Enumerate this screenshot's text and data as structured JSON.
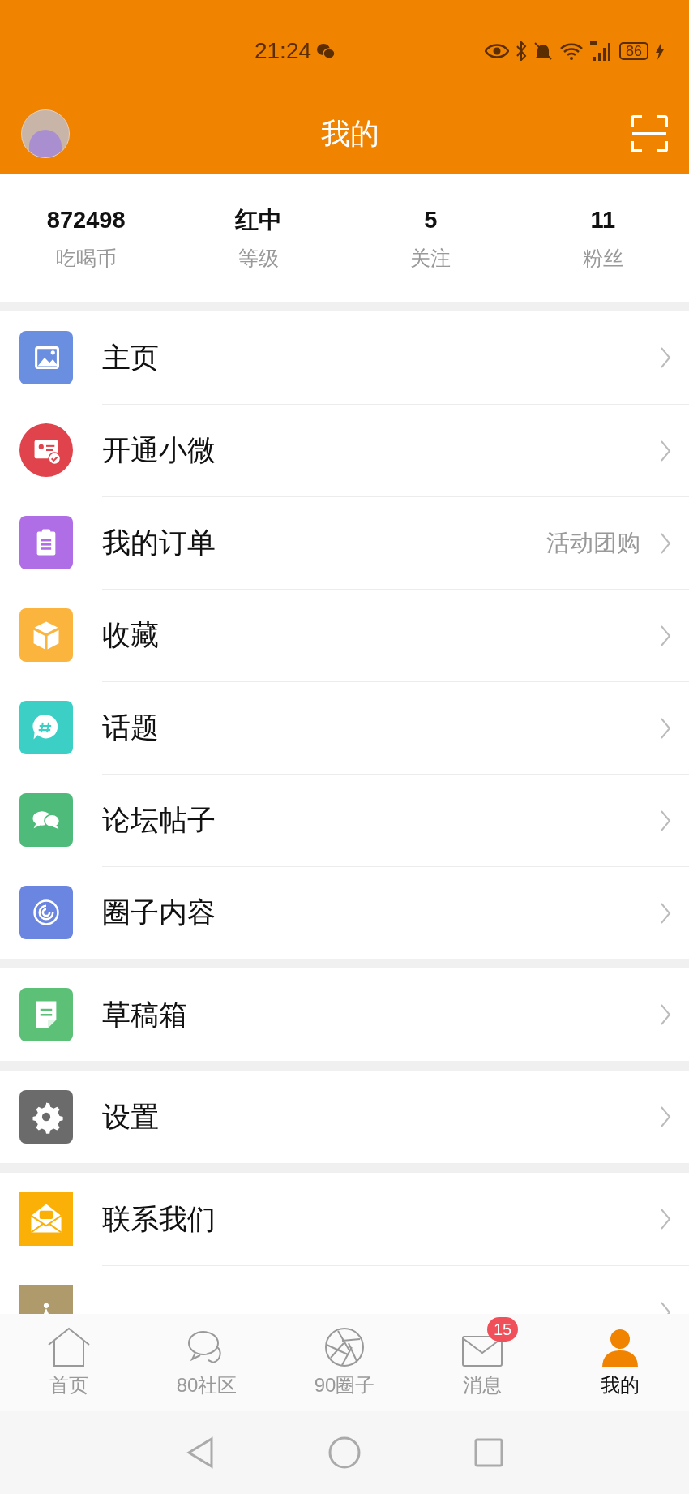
{
  "status_bar": {
    "time": "21:24",
    "battery": "86"
  },
  "header": {
    "title": "我的"
  },
  "stats": [
    {
      "value": "872498",
      "label": "吃喝币"
    },
    {
      "value": "红中",
      "label": "等级"
    },
    {
      "value": "5",
      "label": "关注"
    },
    {
      "value": "11",
      "label": "粉丝"
    }
  ],
  "menu_groups": [
    {
      "items": [
        {
          "kind": "image",
          "color": "#6a8fe0",
          "label": "主页"
        },
        {
          "kind": "card",
          "color": "#e0434b",
          "label": "开通小微"
        },
        {
          "kind": "clipboard",
          "color": "#b06ee6",
          "label": "我的订单",
          "value": "活动团购"
        },
        {
          "kind": "box",
          "color": "#fbb43d",
          "label": "收藏"
        },
        {
          "kind": "hash",
          "color": "#3ccfc6",
          "label": "话题"
        },
        {
          "kind": "chat",
          "color": "#4fbb7a",
          "label": "论坛帖子"
        },
        {
          "kind": "swirl",
          "color": "#6a86e0",
          "label": "圈子内容"
        }
      ]
    },
    {
      "items": [
        {
          "kind": "note",
          "color": "#5cc077",
          "label": "草稿箱"
        }
      ]
    },
    {
      "items": [
        {
          "kind": "gear",
          "color": "#6b6b6b",
          "label": "设置"
        }
      ]
    },
    {
      "items": [
        {
          "kind": "mail",
          "color": "#fbb007",
          "label": "联系我们"
        },
        {
          "kind": "crown",
          "color": "#ae9a6a"
        }
      ]
    }
  ],
  "tab_bar": [
    {
      "kind": "home",
      "label": "首页",
      "selected": false
    },
    {
      "kind": "chat",
      "label": "80社区",
      "selected": false
    },
    {
      "kind": "aperture",
      "label": "90圈子",
      "selected": false
    },
    {
      "kind": "mail",
      "label": "消息",
      "selected": false,
      "badge": "15"
    },
    {
      "kind": "person",
      "label": "我的",
      "selected": true
    }
  ]
}
